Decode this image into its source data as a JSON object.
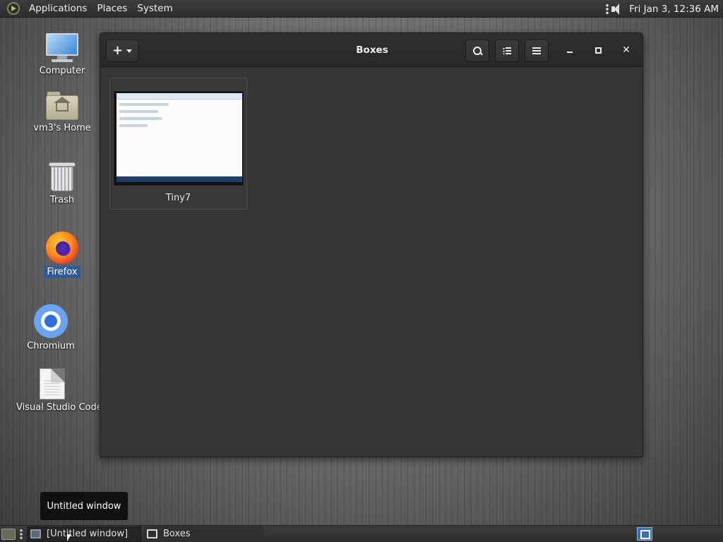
{
  "top_panel": {
    "menus": [
      "Applications",
      "Places",
      "System"
    ],
    "clock": "Fri Jan  3, 12:36 AM"
  },
  "desktop": {
    "icons": [
      {
        "label": "Computer",
        "icon": "computer-icon"
      },
      {
        "label": "vm3's Home",
        "icon": "home-folder-icon"
      },
      {
        "label": "Trash",
        "icon": "trash-icon"
      },
      {
        "label": "Firefox",
        "icon": "firefox-icon",
        "selected": true
      },
      {
        "label": "Chromium",
        "icon": "chromium-icon"
      },
      {
        "label": "Visual Studio Code",
        "icon": "document-icon"
      }
    ]
  },
  "window": {
    "title": "Boxes",
    "new_button_label": "+",
    "machines": [
      {
        "name": "Tiny7"
      }
    ]
  },
  "tooltip": "Untitled window",
  "taskbar": {
    "tasks": [
      "[Untitled window]",
      "Boxes"
    ]
  },
  "colors": {
    "panel": "#2e2e2e",
    "window_bg": "#353535",
    "selection": "#2f5b9b"
  }
}
